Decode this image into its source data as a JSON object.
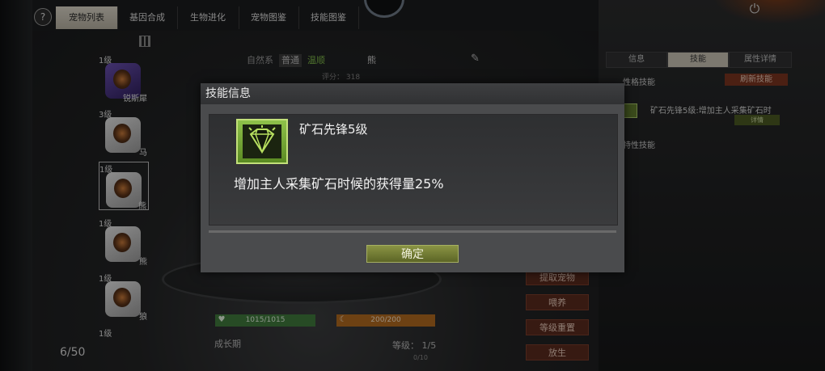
{
  "tabs": [
    {
      "label": "宠物列表",
      "active": true
    },
    {
      "label": "基因合成"
    },
    {
      "label": "生物进化"
    },
    {
      "label": "宠物图鉴"
    },
    {
      "label": "技能图鉴"
    }
  ],
  "help_icon": "question-icon",
  "pets": [
    {
      "level": "1级",
      "name": "锐斯犀"
    },
    {
      "level": "3级",
      "name": "马"
    },
    {
      "level": "1级",
      "name": "熊",
      "selected": true
    },
    {
      "level": "1级",
      "name": "熊"
    },
    {
      "level": "1级",
      "name": "狼"
    },
    {
      "level": "1级",
      "name": ""
    }
  ],
  "pet_count": "6/50",
  "pet_header": {
    "attr1": "自然系",
    "attr2": "普通",
    "attr3": "温顺",
    "name": "熊",
    "score": "评分： 318"
  },
  "right_panel": {
    "tabs": [
      "信息",
      "技能",
      "属性详情"
    ],
    "active_tab": "技能",
    "personality_label": "性格技能",
    "refresh_label": "刷新技能",
    "skill_text": "矿石先锋5级:增加主人采集矿石时",
    "detail_label": "详情",
    "trait_label": "特性技能"
  },
  "stats": {
    "hp": "1015/1015",
    "energy": "200/200",
    "growth_label": "成长期",
    "level": "等级： 1/5",
    "exp": "0/10"
  },
  "actions": [
    "提取宠物",
    "喂养",
    "等级重置",
    "放生"
  ],
  "modal": {
    "title": "技能信息",
    "skill_name": "矿石先锋5级",
    "skill_desc": "增加主人采集矿石时候的获得量25%",
    "confirm": "确定"
  },
  "colors": {
    "accent_green": "#7fb84a",
    "button_red": "#5a2a1e",
    "confirm_olive": "#8a9444"
  }
}
